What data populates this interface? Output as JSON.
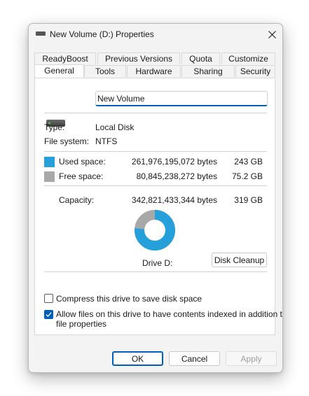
{
  "window": {
    "title": "New Volume (D:) Properties"
  },
  "tabs": {
    "row1": [
      "ReadyBoost",
      "Previous Versions",
      "Quota",
      "Customize"
    ],
    "row2": [
      "General",
      "Tools",
      "Hardware",
      "Sharing",
      "Security"
    ],
    "active": "General"
  },
  "general": {
    "volume_name": "New Volume",
    "type_label": "Type:",
    "type_value": "Local Disk",
    "fs_label": "File system:",
    "fs_value": "NTFS",
    "used_label": "Used space:",
    "used_bytes": "261,976,195,072 bytes",
    "used_gb": "243 GB",
    "free_label": "Free space:",
    "free_bytes": "80,845,238,272 bytes",
    "free_gb": "75.2 GB",
    "capacity_label": "Capacity:",
    "capacity_bytes": "342,821,433,344 bytes",
    "capacity_gb": "319 GB",
    "drive_label": "Drive D:",
    "cleanup_button": "Disk Cleanup",
    "compress_label": "Compress this drive to save disk space",
    "compress_checked": false,
    "index_label_1": "Allow files on this drive to have contents indexed in addition to",
    "index_label_2": "file properties",
    "index_checked": true,
    "used_fraction": 0.764,
    "used_color": "#26a0da",
    "free_color": "#a8a8a8"
  },
  "footer": {
    "ok": "OK",
    "cancel": "Cancel",
    "apply": "Apply"
  },
  "icons": {
    "close": "close-icon",
    "drive": "hard-drive-icon",
    "check": "checkmark-icon"
  }
}
